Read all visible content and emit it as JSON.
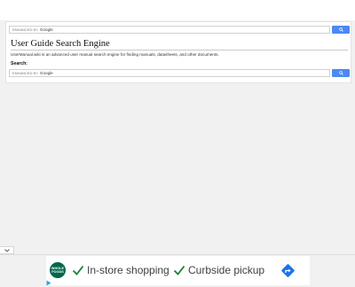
{
  "top_search": {
    "placeholder_prefix": "ENHANCED BY",
    "placeholder_brand": "Google",
    "button_icon": "search-icon"
  },
  "main": {
    "title": "User Guide Search Engine",
    "description": "UserManual.wiki is an advanced user manual search engine for finding manuals, datasheets, and other documents.",
    "search_label": "Search:"
  },
  "bottom_search": {
    "placeholder_prefix": "ENHANCED BY",
    "placeholder_brand": "Google",
    "button_icon": "search-icon"
  },
  "ad": {
    "logo_line1": "WHOLE",
    "logo_line2": "FOODS",
    "item1": "In-store shopping",
    "item2": "Curbside pickup",
    "directions_icon": "directions-icon",
    "adchoices_icon": "adchoices-icon"
  },
  "colors": {
    "search_button": "#4a8af4",
    "logo_bg": "#00674b",
    "check": "#188038",
    "directions": "#1a73e8"
  }
}
